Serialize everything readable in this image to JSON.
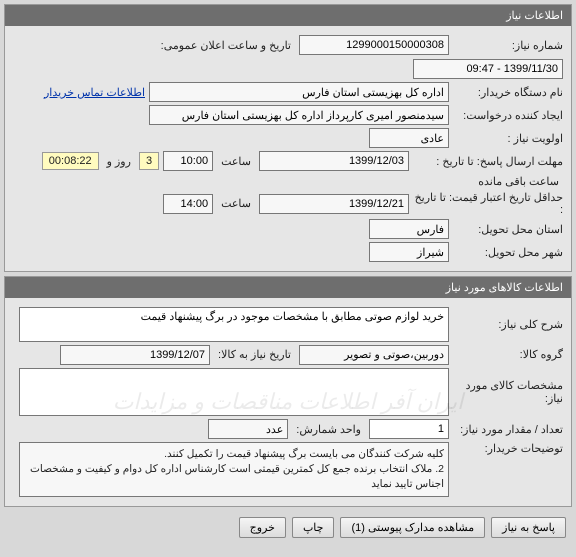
{
  "panel1": {
    "title": "اطلاعات نیاز",
    "need_number_label": "شماره نیاز:",
    "need_number": "1299000150000308",
    "public_datetime_label": "تاریخ و ساعت اعلان عمومی:",
    "public_datetime": "1399/11/30 - 09:47",
    "buyer_org_label": "نام دستگاه خریدار:",
    "buyer_org": "اداره کل بهزیستی استان فارس",
    "contact_link": "اطلاعات تماس خریدار",
    "requester_label": "ایجاد کننده درخواست:",
    "requester": "سیدمنصور امیری کارپرداز اداره کل بهزیستی استان فارس",
    "priority_label": "اولویت نیاز :",
    "priority": "عادی",
    "deadline_label": "مهلت ارسال پاسخ:",
    "to_date_label": "تا تاریخ :",
    "deadline_date": "1399/12/03",
    "time_label": "ساعت",
    "deadline_time": "10:00",
    "days_remaining": "3",
    "days_label": "روز و",
    "countdown": "00:08:22",
    "remaining_label": "ساعت باقی مانده",
    "validity_label": "حداقل تاریخ اعتبار قیمت:",
    "validity_date": "1399/12/21",
    "validity_time": "14:00",
    "province_label": "استان محل تحویل:",
    "province": "فارس",
    "city_label": "شهر محل تحویل:",
    "city": "شیراز"
  },
  "panel2": {
    "title": "اطلاعات کالاهای مورد نیاز",
    "desc_label": "شرح کلی نیاز:",
    "desc": "خرید لوازم صوتی مطابق با مشخصات موجود در برگ پیشنهاد قیمت",
    "group_label": "گروه کالا:",
    "group": "دوربین،صوتی و تصویر",
    "need_by_label": "تاریخ نیاز به کالا:",
    "need_by": "1399/12/07",
    "spec_label": "مشخصات کالای مورد نیاز:",
    "spec": "",
    "qty_label": "تعداد / مقدار مورد نیاز:",
    "qty": "1",
    "unit_label": "واحد شمارش:",
    "unit": "عدد",
    "comments_label": "توضیحات خریدار:",
    "comments_line1": "کلیه شرکت کنندگان می بایست برگ پیشنهاد قیمت را تکمیل کنند.",
    "comments_line2": "2. ملاک انتخاب برنده جمع کل کمترین قیمتی است کارشناس اداره کل  دوام و کیفیت و مشخصات اجناس تایید نماید"
  },
  "footer": {
    "reply": "پاسخ به نیاز",
    "attachments": "مشاهده مدارک پیوستی (1)",
    "print": "چاپ",
    "exit": "خروج"
  },
  "watermark": "ایران آفر   اطلاعات مناقصات و مزایدات"
}
